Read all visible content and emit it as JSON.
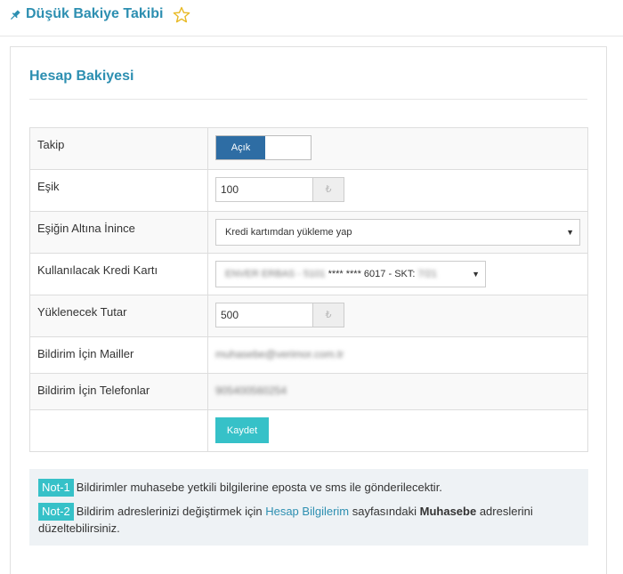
{
  "header": {
    "title": "Düşük Bakiye Takibi",
    "pin_icon": "pin-icon",
    "star_icon": "star-outline-icon"
  },
  "card": {
    "title": "Hesap Bakiyesi"
  },
  "form": {
    "takip": {
      "label": "Takip",
      "toggle_on_label": "Açık",
      "state": "on"
    },
    "esik": {
      "label": "Eşik",
      "value": "100",
      "currency_symbol": "₺"
    },
    "esik_altina": {
      "label": "Eşiğin Altına İnince",
      "selected": "Kredi kartımdan yükleme yap"
    },
    "kredi_karti": {
      "label": "Kullanılacak Kredi Kartı",
      "card_holder": "ENVER ERBAS - 5101",
      "masked_number": "**** **** 6017",
      "skt_label": "- SKT:",
      "skt_value": "7/21"
    },
    "yuklenecek": {
      "label": "Yüklenecek Tutar",
      "value": "500",
      "currency_symbol": "₺"
    },
    "mailler": {
      "label": "Bildirim İçin Mailler",
      "value": "muhasebe@verimor.com.tr"
    },
    "telefonlar": {
      "label": "Bildirim İçin Telefonlar",
      "value": "905400560254"
    },
    "save_label": "Kaydet"
  },
  "notes": {
    "note1_badge": "Not-1",
    "note1_text": "Bildirimler muhasebe yetkili bilgilerine eposta ve sms ile gönderilecektir.",
    "note2_badge": "Not-2",
    "note2_text_before": "Bildirim adreslerinizi değiştirmek için ",
    "note2_link": "Hesap Bilgilerim",
    "note2_text_middle": " sayfasındaki ",
    "note2_bold": "Muhasebe",
    "note2_text_after": " adreslerini düzeltebilirsiniz."
  },
  "colors": {
    "accent": "#2d8fb1",
    "primary_toggle": "#2e6da4",
    "button": "#36c1c8",
    "notes_bg": "#eef2f5"
  }
}
